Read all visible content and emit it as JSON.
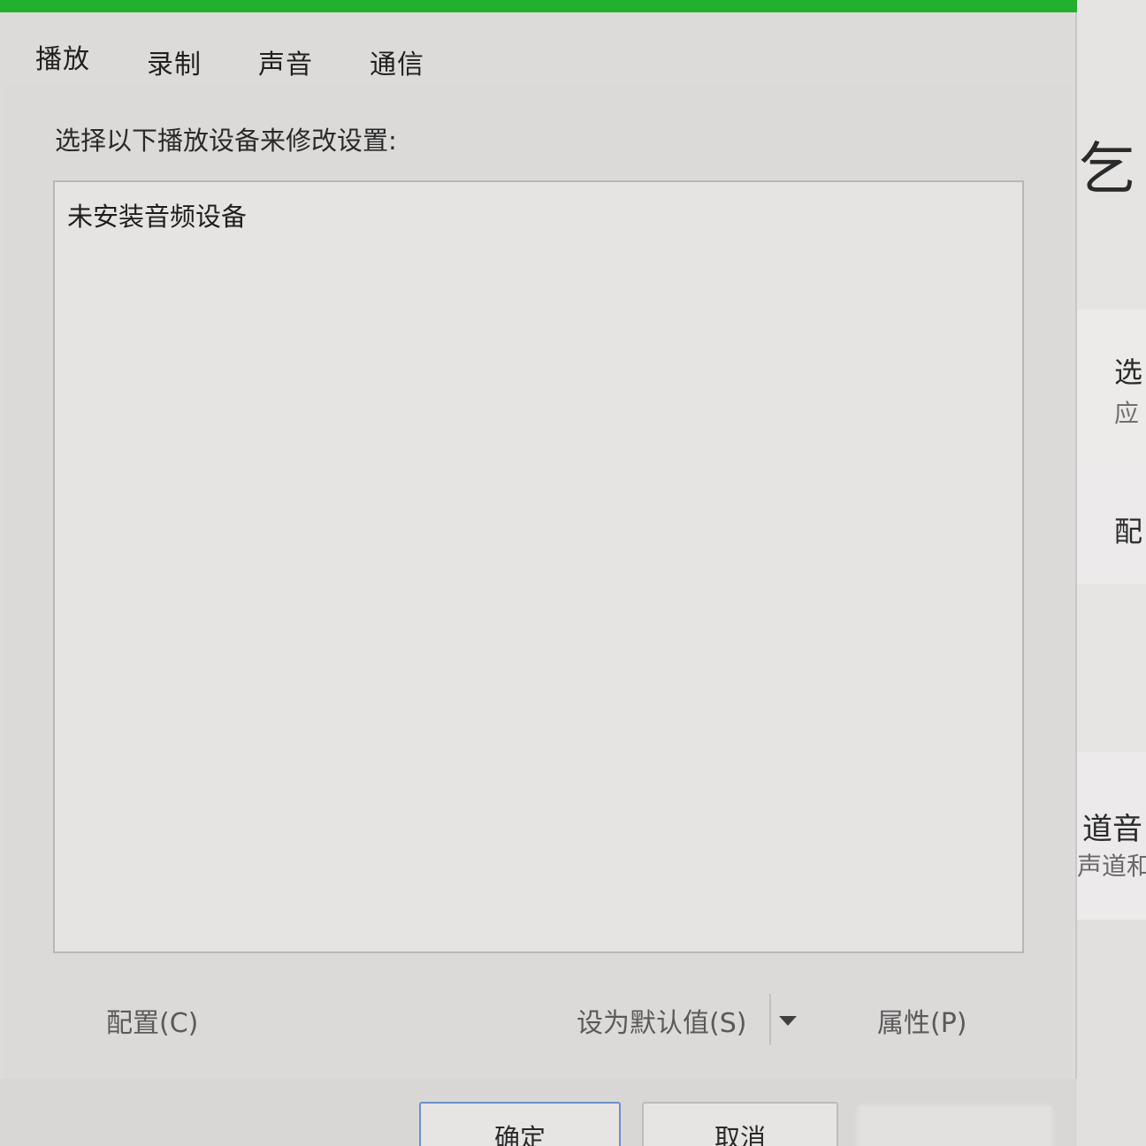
{
  "dialog": {
    "tabs": [
      {
        "label": "播放"
      },
      {
        "label": "录制"
      },
      {
        "label": "声音"
      },
      {
        "label": "通信"
      }
    ],
    "active_tab": "播放",
    "instruction": "选择以下播放设备来修改设置:",
    "device_list": {
      "empty_message": "未安装音频设备"
    },
    "buttons": {
      "configure": "配置(C)",
      "set_default": "设为默认值(S)",
      "properties": "属性(P)"
    },
    "footer": {
      "ok": "确定",
      "cancel": "取消"
    }
  },
  "background_window": {
    "fragments": [
      "乞",
      "选",
      "应",
      "配",
      "道音",
      "声道和"
    ]
  },
  "colors": {
    "accent": "#22b02e",
    "dialog_bg": "#dddbda",
    "list_bg": "#e6e4e3",
    "default_button_border": "#6d8fc9"
  },
  "icons": {
    "split_dropdown": "chevron-down-icon"
  }
}
